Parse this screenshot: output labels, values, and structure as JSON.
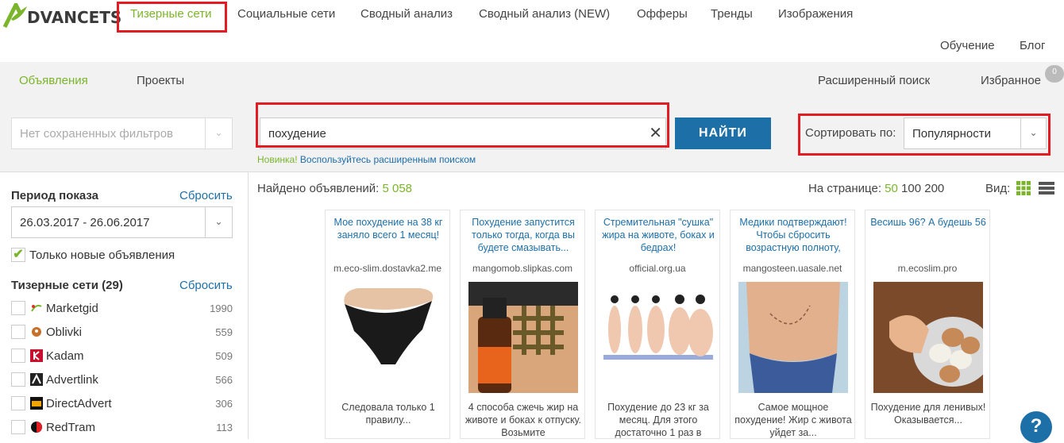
{
  "logo": {
    "text": "DVANCETS",
    "icon": "leaf-a-logo"
  },
  "nav": {
    "main": [
      "Тизерные сети",
      "Социальные сети",
      "Сводный анализ",
      "Сводный анализ (NEW)",
      "Офферы",
      "Тренды",
      "Изображения"
    ],
    "secondary": [
      "Обучение",
      "Блог"
    ]
  },
  "subnav": {
    "left": [
      "Объявления",
      "Проекты"
    ],
    "right": [
      "Расширенный поиск",
      "Избранное"
    ],
    "favorites_count": "0"
  },
  "search": {
    "saved_filters_placeholder": "Нет сохраненных фильтров",
    "query": "похудение",
    "find_button": "НАЙТИ",
    "hint_new": "Новинка!",
    "hint_text": "Воспользуйтесь расширенным поиском",
    "sort_label": "Сортировать по:",
    "sort_value": "Популярности"
  },
  "sidebar": {
    "period_title": "Период показа",
    "reset": "Сбросить",
    "period_value": "26.03.2017 - 26.06.2017",
    "only_new_label": "Только новые объявления",
    "only_new_checked": true,
    "networks_title": "Тизерные сети (29)",
    "networks": [
      {
        "name": "Marketgid",
        "count": "1990",
        "icon": "marketgid-icon"
      },
      {
        "name": "Oblivki",
        "count": "559",
        "icon": "oblivki-icon"
      },
      {
        "name": "Kadam",
        "count": "509",
        "icon": "kadam-icon"
      },
      {
        "name": "Advertlink",
        "count": "566",
        "icon": "advertlink-icon"
      },
      {
        "name": "DirectAdvert",
        "count": "306",
        "icon": "directadvert-icon"
      },
      {
        "name": "RedTram",
        "count": "113",
        "icon": "redtram-icon"
      }
    ]
  },
  "results": {
    "found_label": "Найдено объявлений:",
    "found_count": "5 058",
    "per_page_label": "На странице:",
    "per_page_options": [
      "50",
      "100",
      "200"
    ],
    "per_page_selected": "50",
    "view_label": "Вид:"
  },
  "cards": [
    {
      "title": "Мое похудение на 38 кг заняло всего 1 месяц!",
      "domain": "m.eco-slim.dostavka2.me",
      "desc": "Следовала только 1 правилу..."
    },
    {
      "title": "Похудение запустится только тогда, когда вы будете смазывать...",
      "domain": "mangomob.slipkas.com",
      "desc": "4 способа сжечь жир на животе и боках к отпуску. Возьмите"
    },
    {
      "title": "Стремительная \"сушка\" жира на животе, боках и бедрах!",
      "domain": "official.org.ua",
      "desc": "Похудение до 23 кг за месяц. Для этого достаточно 1 раз в"
    },
    {
      "title": "Медики подтверждают! Чтобы сбросить возрастную полноту,",
      "domain": "mangosteen.uasale.net",
      "desc": "Самое мощное похудение! Жир с живота уйдет за..."
    },
    {
      "title": "Весишь 96? А будешь 56",
      "domain": "m.ecoslim.pro",
      "desc": "Похудение для ленивых! Оказывается..."
    }
  ],
  "help": "?"
}
